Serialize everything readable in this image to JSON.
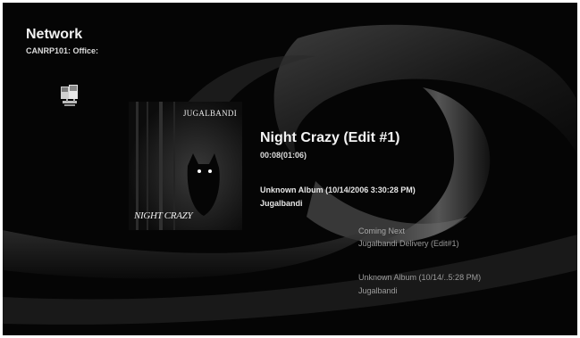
{
  "header": {
    "title": "Network",
    "subtitle": "CANRP101: Office:"
  },
  "icons": {
    "network": "network-computer-icon"
  },
  "album_art": {
    "band_text": "JUGALBANDI",
    "title_text": "NIGHT CRAZY"
  },
  "now_playing": {
    "title": "Night Crazy (Edit #1)",
    "time": "00:08(01:06)",
    "album": "Unknown Album (10/14/2006 3:30:28 PM)",
    "artist": "Jugalbandi"
  },
  "coming_next": {
    "label": "Coming Next",
    "track": "Jugalbandi Delivery (Edit#1)",
    "album": "Unknown Album (10/14/..5:28 PM)",
    "artist": "Jugalbandi"
  },
  "colors": {
    "background": "#050505",
    "text": "#f2f2f2",
    "dim_text": "#9c9c9c"
  }
}
